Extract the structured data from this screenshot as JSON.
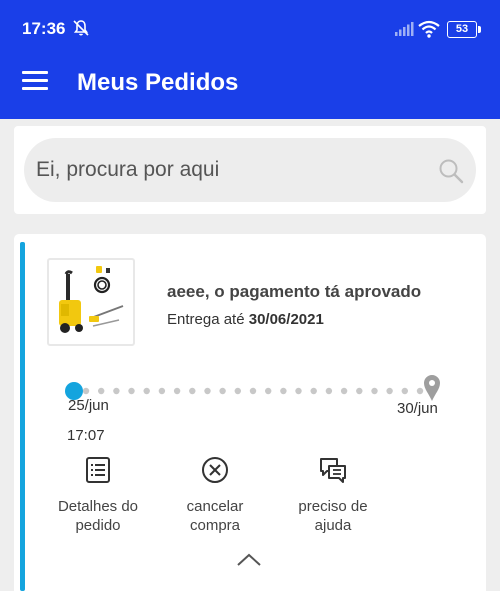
{
  "status_bar": {
    "time": "17:36",
    "battery": "53",
    "icons": [
      "dnd-off-icon",
      "signal-icon",
      "wifi-icon",
      "battery-icon"
    ]
  },
  "app_bar": {
    "title": "Meus Pedidos",
    "menu_icon": "hamburger-menu-icon",
    "color": "#1a3fe8"
  },
  "search": {
    "placeholder": "Ei, procura por aqui",
    "icon": "search-icon"
  },
  "order": {
    "status": "aeee, o pagamento tá aprovado",
    "delivery_prefix": "Entrega até",
    "delivery_date": "30/06/2021",
    "product_image": "pressure-washer-product-image",
    "accent_color": "#14a4de",
    "timeline": {
      "start_date": "25/jun",
      "start_time": "17:07",
      "end_date": "30/jun",
      "progress": 0
    },
    "actions": [
      {
        "label_line1": "Detalhes do",
        "label_line2": "pedido",
        "icon": "list-details-icon"
      },
      {
        "label_line1": "cancelar",
        "label_line2": "compra",
        "icon": "cancel-circle-icon"
      },
      {
        "label_line1": "preciso de",
        "label_line2": "ajuda",
        "icon": "chat-help-icon"
      }
    ],
    "collapse_icon": "chevron-up-icon"
  }
}
